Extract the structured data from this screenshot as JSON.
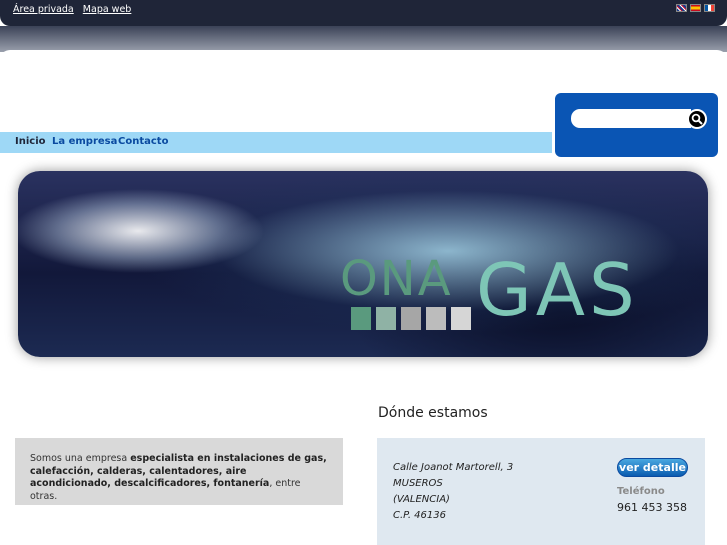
{
  "topbar": {
    "links": [
      "Área privada",
      "Mapa web"
    ],
    "flags": [
      "flag-en-icon",
      "flag-es-icon",
      "flag-fr-icon"
    ]
  },
  "nav": {
    "items": [
      "Inicio",
      "La empresa",
      "Contacto"
    ]
  },
  "search": {
    "placeholder": "",
    "value": ""
  },
  "banner": {
    "logo_part1": "ONA",
    "logo_part2": "GAS",
    "square_colors": [
      "#5a9a7e",
      "#8fb2a5",
      "#a6a6a6",
      "#bcbcbc",
      "#d6d6d6"
    ]
  },
  "intro": {
    "prefix": "Somos una empresa ",
    "bold": "especialista en instalaciones de gas, calefacción, calderas, calentadores, aire acondicionado, descalcificadores, fontanería",
    "suffix": ", entre otras."
  },
  "location": {
    "title": "Dónde estamos",
    "address_lines": [
      "Calle  Joanot Martorell, 3",
      "MUSEROS",
      "(VALENCIA)",
      "C.P. 46136"
    ],
    "detail_button": "ver detalle",
    "phone_label": "Teléfono",
    "phone": "961 453 358"
  },
  "colors": {
    "topbar": "#1f2538",
    "nav": "#9ed8f6",
    "search_panel": "#0a55b4",
    "intro_bg": "#d9d9d9",
    "address_bg": "#dfe8f0"
  }
}
